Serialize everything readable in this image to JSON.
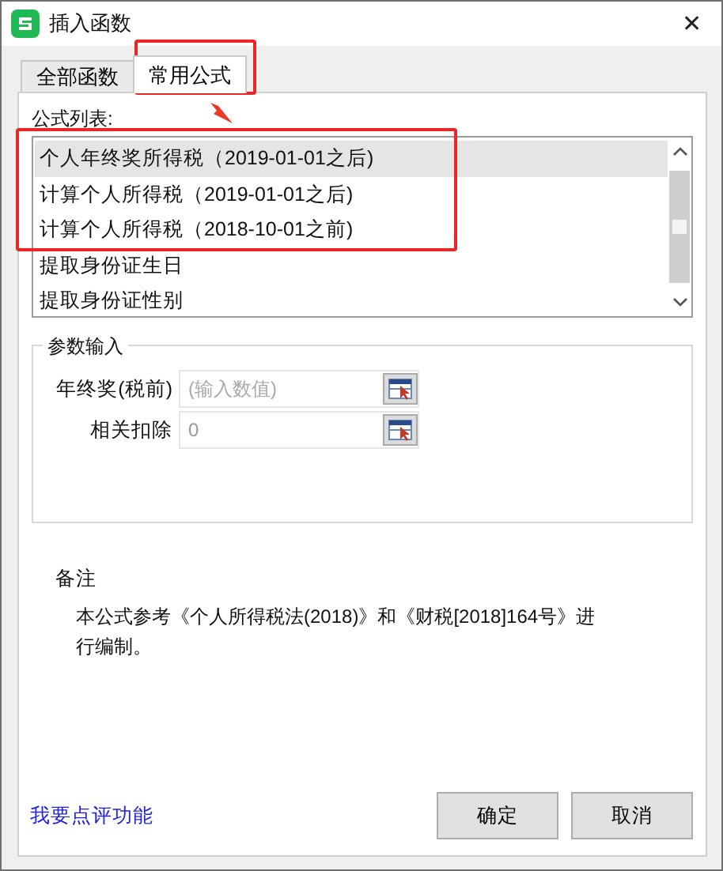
{
  "window": {
    "title": "插入函数",
    "close": "✕"
  },
  "tabs": [
    {
      "label": "全部函数",
      "selected": false
    },
    {
      "label": "常用公式",
      "selected": true
    }
  ],
  "formula_list": {
    "label": "公式列表:",
    "items": [
      {
        "label": "个人年终奖所得税（2019-01-01之后)",
        "selected": true
      },
      {
        "label": "计算个人所得税（2019-01-01之后)",
        "selected": false
      },
      {
        "label": "计算个人所得税（2018-10-01之前)",
        "selected": false
      },
      {
        "label": "提取身份证生日",
        "selected": false
      },
      {
        "label": "提取身份证性别",
        "selected": false
      }
    ]
  },
  "parameters": {
    "title": "参数输入",
    "fields": [
      {
        "label": "年终奖(税前)",
        "placeholder": "(输入数值)"
      },
      {
        "label": "相关扣除",
        "value": "0"
      }
    ]
  },
  "note": {
    "title": "备注",
    "text": "本公式参考《个人所得税法(2018)》和《财税[2018]164号》进行编制。"
  },
  "feedback_link": "我要点评功能",
  "buttons": [
    "确定",
    "取消"
  ],
  "annotations": [
    {
      "kind": "box"
    },
    {
      "kind": "arrow"
    },
    {
      "kind": "box"
    }
  ]
}
